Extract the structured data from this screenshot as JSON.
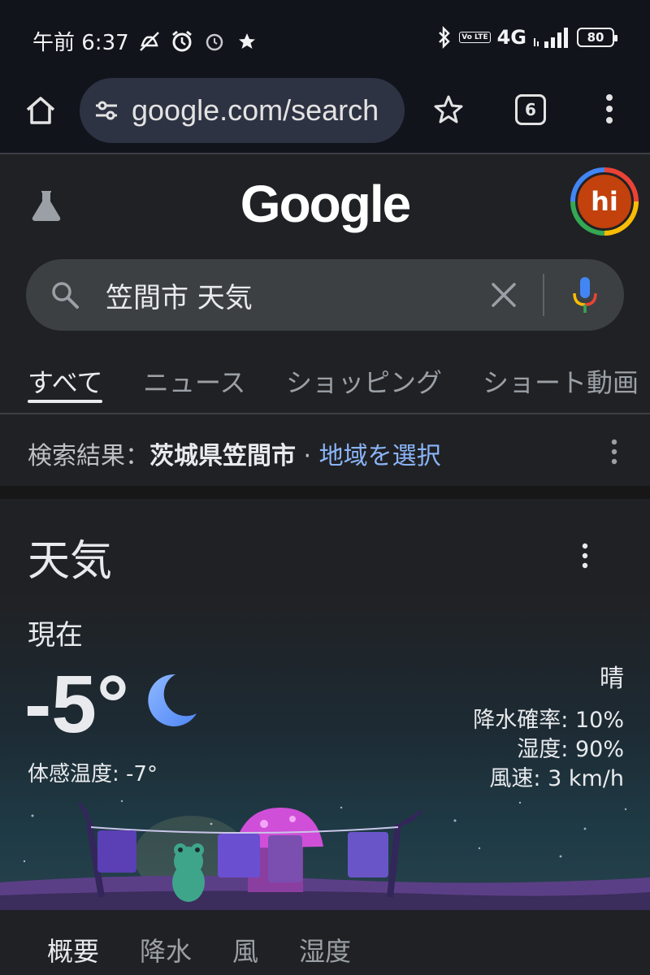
{
  "status_bar": {
    "time": "午前 6:37",
    "network": "4G",
    "volte_label": "Vo LTE",
    "battery": "80"
  },
  "browser": {
    "url": "google.com/search",
    "tab_count": "6"
  },
  "google": {
    "logo": "Google",
    "avatar_initials": "hi",
    "search_query": "笠間市 天気"
  },
  "filters": [
    {
      "label": "すべて",
      "active": true
    },
    {
      "label": "ニュース",
      "active": false
    },
    {
      "label": "ショッピング",
      "active": false
    },
    {
      "label": "ショート動画",
      "active": false
    }
  ],
  "location": {
    "prefix": "検索結果：",
    "place": "茨城県笠間市",
    "separator": " · ",
    "link": "地域を選択"
  },
  "weather": {
    "title": "天気",
    "now_label": "現在",
    "temperature": "-5°",
    "feels_like": "体感温度: -7°",
    "condition": "晴",
    "precip": "降水確率: 10%",
    "humidity": "湿度: 90%",
    "wind": "風速: 3 km/h",
    "tabs": [
      "概要",
      "降水",
      "風",
      "湿度"
    ]
  }
}
